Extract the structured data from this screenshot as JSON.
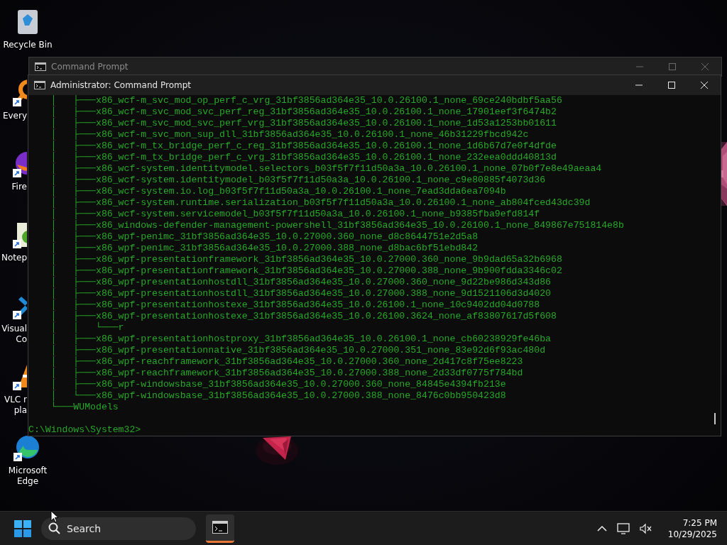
{
  "desktop": {
    "icons": [
      {
        "kind": "recycle",
        "shortcut": false,
        "label_lines": [
          "Recycle Bin"
        ]
      },
      {
        "kind": "magnifier",
        "shortcut": true,
        "clipped": true,
        "label_lines": [
          "Every"
        ]
      },
      {
        "kind": "fox",
        "shortcut": true,
        "clipped": true,
        "label_lines": [
          "Fire"
        ]
      },
      {
        "kind": "notepad",
        "shortcut": true,
        "clipped": true,
        "label_lines": [
          "Notep"
        ]
      },
      {
        "kind": "code",
        "shortcut": true,
        "clipped": true,
        "label_lines": [
          "Visual",
          "Co"
        ]
      },
      {
        "kind": "cone",
        "shortcut": true,
        "clipped": true,
        "label_lines": [
          "VLC r",
          "pla"
        ]
      },
      {
        "kind": "edge",
        "shortcut": true,
        "label_lines": [
          "Microsoft",
          "Edge"
        ]
      }
    ]
  },
  "background_window": {
    "title": "Command Prompt"
  },
  "window": {
    "title": "Administrator: Command Prompt",
    "lines": [
      "    │   ├───x86_wcf-m_svc_mod_op_perf_c_vrg_31bf3856ad364e35_10.0.26100.1_none_69ce240bdbf5aa56",
      "    │   ├───x86_wcf-m_svc_mod_svc_perf_reg_31bf3856ad364e35_10.0.26100.1_none_17901eef3f6474b2",
      "    │   ├───x86_wcf-m_svc_mod_svc_perf_vrg_31bf3856ad364e35_10.0.26100.1_none_1d53a1253bb01611",
      "    │   ├───x86_wcf-m_svc_mon_sup_dll_31bf3856ad364e35_10.0.26100.1_none_46b31229fbcd942c",
      "    │   ├───x86_wcf-m_tx_bridge_perf_c_reg_31bf3856ad364e35_10.0.26100.1_none_1d6b67d7e0f4dfde",
      "    │   ├───x86_wcf-m_tx_bridge_perf_c_vrg_31bf3856ad364e35_10.0.26100.1_none_232eea0ddd40813d",
      "    │   ├───x86_wcf-system.identitymodel.selectors_b03f5f7f11d50a3a_10.0.26100.1_none_07b0f7e8e49aeaa4",
      "    │   ├───x86_wcf-system.identitymodel_b03f5f7f11d50a3a_10.0.26100.1_none_c9e80885f4073d36",
      "    │   ├───x86_wcf-system.io.log_b03f5f7f11d50a3a_10.0.26100.1_none_7ead3dda6ea7094b",
      "    │   ├───x86_wcf-system.runtime.serialization_b03f5f7f11d50a3a_10.0.26100.1_none_ab804fced43dc39d",
      "    │   ├───x86_wcf-system.servicemodel_b03f5f7f11d50a3a_10.0.26100.1_none_b9385fba9efd814f",
      "    │   ├───x86_windows-defender-management-powershell_31bf3856ad364e35_10.0.26100.1_none_849867e751814e8b",
      "    │   ├───x86_wpf-penimc_31bf3856ad364e35_10.0.27000.360_none_d8c8644751e2d5a8",
      "    │   ├───x86_wpf-penimc_31bf3856ad364e35_10.0.27000.388_none_d8bac6bf51ebd842",
      "    │   ├───x86_wpf-presentationframework_31bf3856ad364e35_10.0.27000.360_none_9b9dad65a32b6968",
      "    │   ├───x86_wpf-presentationframework_31bf3856ad364e35_10.0.27000.388_none_9b900fdda3346c02",
      "    │   ├───x86_wpf-presentationhostdll_31bf3856ad364e35_10.0.27000.360_none_9d22be986d343d86",
      "    │   ├───x86_wpf-presentationhostdll_31bf3856ad364e35_10.0.27000.388_none_9d1521106d3d4020",
      "    │   ├───x86_wpf-presentationhostexe_31bf3856ad364e35_10.0.26100.1_none_10c9402dd04d0788",
      "    │   ├───x86_wpf-presentationhostexe_31bf3856ad364e35_10.0.26100.3624_none_af83807617d5f608",
      "    │   │   └───r",
      "    │   ├───x86_wpf-presentationhostproxy_31bf3856ad364e35_10.0.26100.1_none_cb60238929fe46ba",
      "    │   ├───x86_wpf-presentationnative_31bf3856ad364e35_10.0.27000.351_none_83e92d6f93ac480d",
      "    │   ├───x86_wpf-reachframework_31bf3856ad364e35_10.0.27000.360_none_2d417c8f75ee8223",
      "    │   ├───x86_wpf-reachframework_31bf3856ad364e35_10.0.27000.388_none_2d33df0775f784bd",
      "    │   ├───x86_wpf-windowsbase_31bf3856ad364e35_10.0.27000.360_none_84845e4394fb213e",
      "    │   └───x86_wpf-windowsbase_31bf3856ad364e35_10.0.27000.388_none_8476c0bb950423d8",
      "    └───WUModels"
    ],
    "prompt": "C:\\Windows\\System32>"
  },
  "taskbar": {
    "search": {
      "placeholder": "Search"
    },
    "apps": [
      {
        "kind": "terminal",
        "selected": true
      }
    ],
    "time": "7:25 PM",
    "date": "10/29/2025"
  }
}
